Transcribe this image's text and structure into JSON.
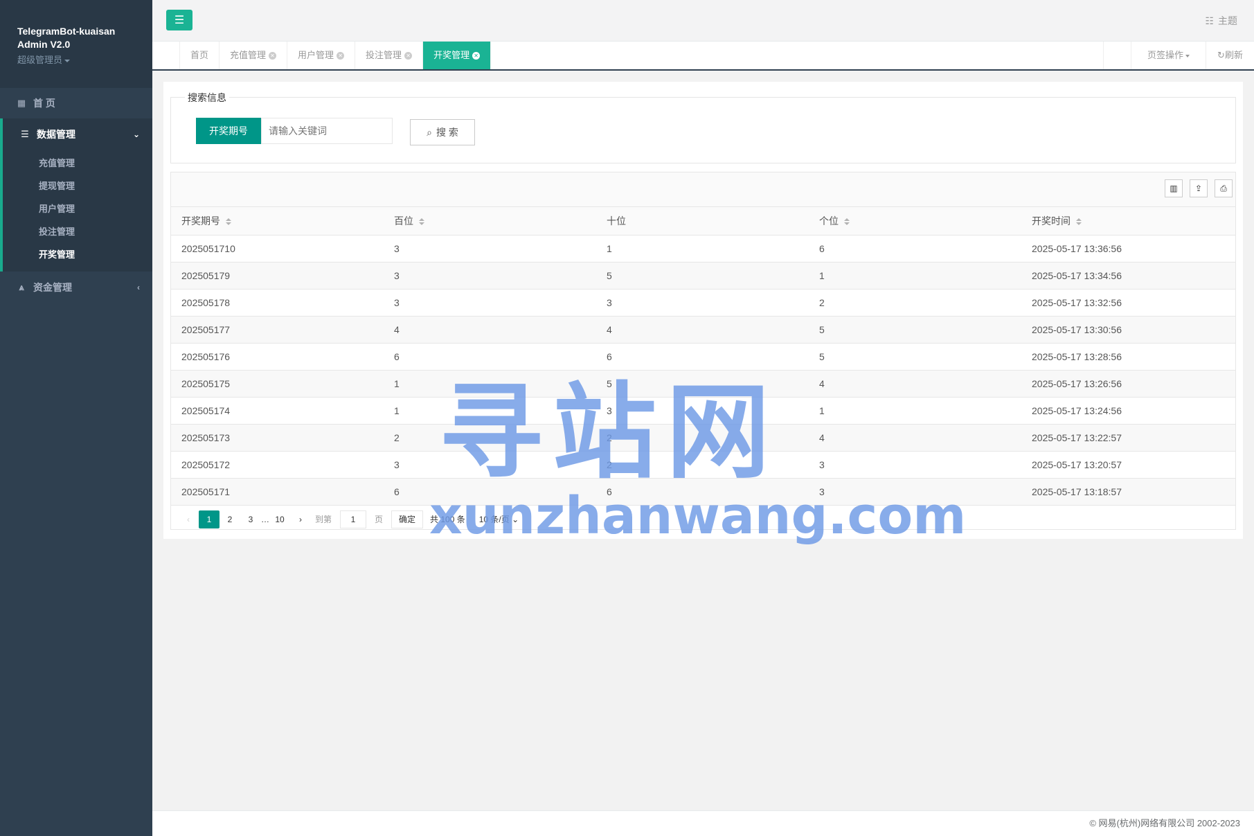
{
  "brand": {
    "title": "TelegramBot-kuaisan Admin V2.0",
    "role": "超级管理员"
  },
  "sidebar": {
    "home": "首 页",
    "data_group": "数据管理",
    "data_items": [
      "充值管理",
      "提现管理",
      "用户管理",
      "投注管理",
      "开奖管理"
    ],
    "fund_group": "资金管理"
  },
  "topbar": {
    "theme": "主题"
  },
  "tabs": {
    "items": [
      "首页",
      "充值管理",
      "用户管理",
      "投注管理",
      "开奖管理"
    ],
    "ops": "页签操作",
    "refresh": "刷新"
  },
  "search": {
    "legend": "搜索信息",
    "label": "开奖期号",
    "placeholder": "请输入关键词",
    "button": "搜 索"
  },
  "table": {
    "headers": [
      "开奖期号",
      "百位",
      "十位",
      "个位",
      "开奖时间"
    ],
    "rows": [
      [
        "2025051710",
        "3",
        "1",
        "6",
        "2025-05-17 13:36:56"
      ],
      [
        "202505179",
        "3",
        "5",
        "1",
        "2025-05-17 13:34:56"
      ],
      [
        "202505178",
        "3",
        "3",
        "2",
        "2025-05-17 13:32:56"
      ],
      [
        "202505177",
        "4",
        "4",
        "5",
        "2025-05-17 13:30:56"
      ],
      [
        "202505176",
        "6",
        "6",
        "5",
        "2025-05-17 13:28:56"
      ],
      [
        "202505175",
        "1",
        "5",
        "4",
        "2025-05-17 13:26:56"
      ],
      [
        "202505174",
        "1",
        "3",
        "1",
        "2025-05-17 13:24:56"
      ],
      [
        "202505173",
        "2",
        "2",
        "4",
        "2025-05-17 13:22:57"
      ],
      [
        "202505172",
        "3",
        "2",
        "3",
        "2025-05-17 13:20:57"
      ],
      [
        "202505171",
        "6",
        "6",
        "3",
        "2025-05-17 13:18:57"
      ]
    ]
  },
  "pager": {
    "pages": [
      "1",
      "2",
      "3",
      "…",
      "10"
    ],
    "goto_label": "到第",
    "goto_value": "1",
    "page_unit": "页",
    "ok": "确定",
    "total": "共 100 条",
    "limit": "10 条/页"
  },
  "footer": {
    "copyright": "© 网易(杭州)网络有限公司 2002-2023"
  },
  "watermark": {
    "cn": "寻站网",
    "en": "xunzhanwang.com"
  },
  "colors": {
    "accent": "#1ab394",
    "primary": "#009688",
    "sidebar": "#2f4050"
  }
}
